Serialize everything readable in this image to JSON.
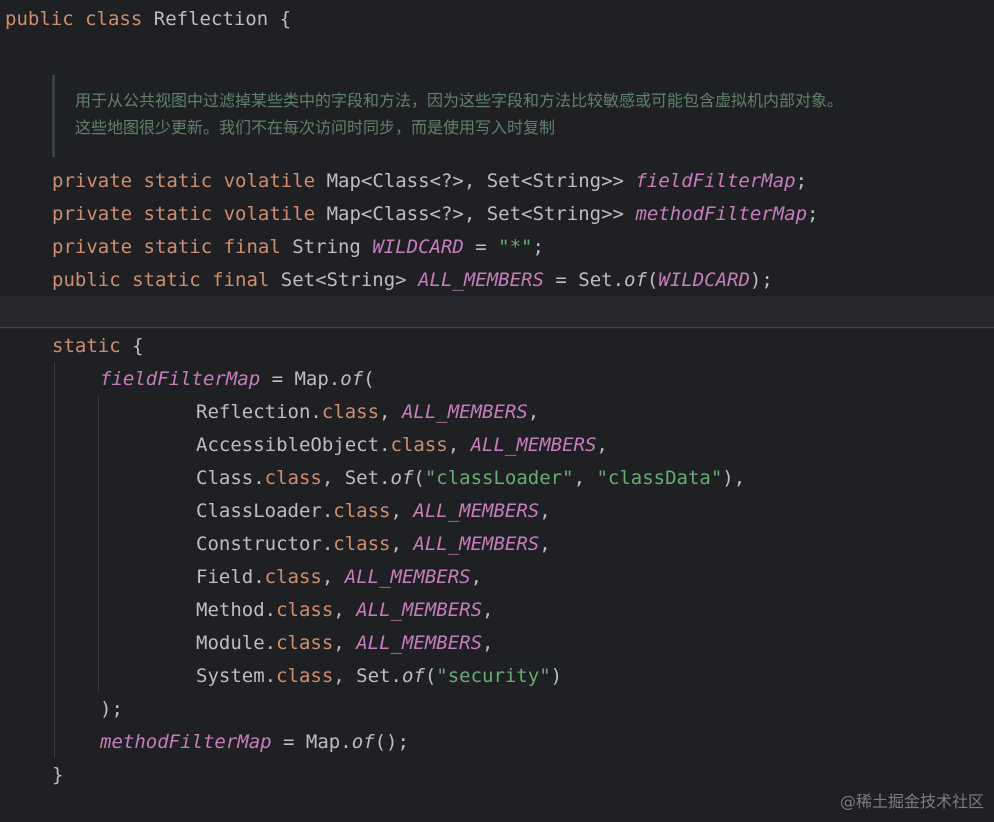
{
  "code": {
    "class_decl": {
      "kw1": "public",
      "kw2": "class",
      "name": "Reflection",
      "brace": "{"
    },
    "doc_comment": {
      "line1": "用于从公共视图中过滤掉某些类中的字段和方法，因为这些字段和方法比较敏感或可能包含虚拟机内部对象。",
      "line2": "这些地图很少更新。我们不在每次访问时同步，而是使用写入时复制"
    },
    "field1": {
      "mods": "private static volatile",
      "type": "Map<Class<?>, Set<String>>",
      "name": "fieldFilterMap",
      "end": ";"
    },
    "field2": {
      "mods": "private static volatile",
      "type": "Map<Class<?>, Set<String>>",
      "name": "methodFilterMap",
      "end": ";"
    },
    "field3": {
      "mods": "private static final",
      "type": "String",
      "name": "WILDCARD",
      "eq": " = ",
      "value": "\"*\"",
      "end": ";"
    },
    "field4": {
      "mods": "public static final",
      "type": "Set<String>",
      "name": "ALL_MEMBERS",
      "eq": " = ",
      "call_pre": "Set.",
      "call": "of",
      "arg_open": "(",
      "arg": "WILDCARD",
      "end": ");"
    },
    "static_block": {
      "kw": "static",
      "brace": " {"
    },
    "assign1": {
      "name": "fieldFilterMap",
      "eq": " = ",
      "pre": "Map.",
      "call": "of",
      "open": "("
    },
    "entries": [
      {
        "cls": "Reflection",
        "dot": ".",
        "kw": "class",
        "sep": ", ",
        "val": "ALL_MEMBERS",
        "end": ","
      },
      {
        "cls": "AccessibleObject",
        "dot": ".",
        "kw": "class",
        "sep": ", ",
        "val": "ALL_MEMBERS",
        "end": ","
      },
      {
        "cls": "Class",
        "dot": ".",
        "kw": "class",
        "sep": ", Set.",
        "call": "of",
        "open": "(",
        "s1": "\"classLoader\"",
        "comma": ", ",
        "s2": "\"classData\"",
        "end": "),"
      },
      {
        "cls": "ClassLoader",
        "dot": ".",
        "kw": "class",
        "sep": ", ",
        "val": "ALL_MEMBERS",
        "end": ","
      },
      {
        "cls": "Constructor",
        "dot": ".",
        "kw": "class",
        "sep": ", ",
        "val": "ALL_MEMBERS",
        "end": ","
      },
      {
        "cls": "Field",
        "dot": ".",
        "kw": "class",
        "sep": ", ",
        "val": "ALL_MEMBERS",
        "end": ","
      },
      {
        "cls": "Method",
        "dot": ".",
        "kw": "class",
        "sep": ", ",
        "val": "ALL_MEMBERS",
        "end": ","
      },
      {
        "cls": "Module",
        "dot": ".",
        "kw": "class",
        "sep": ", ",
        "val": "ALL_MEMBERS",
        "end": ","
      },
      {
        "cls": "System",
        "dot": ".",
        "kw": "class",
        "sep": ", Set.",
        "call": "of",
        "open": "(",
        "s1": "\"security\"",
        "end": ")"
      }
    ],
    "close_call": ");",
    "assign2": {
      "name": "methodFilterMap",
      "eq": " = ",
      "pre": "Map.",
      "call": "of",
      "end": "();"
    },
    "close_block": "}"
  },
  "watermark": "@稀土掘金技术社区",
  "colors": {
    "background": "#1f2023",
    "keyword": "#cf8e6d",
    "field": "#c77dbb",
    "string": "#6aab73",
    "comment": "#5f826b",
    "text": "#bcbec4"
  }
}
